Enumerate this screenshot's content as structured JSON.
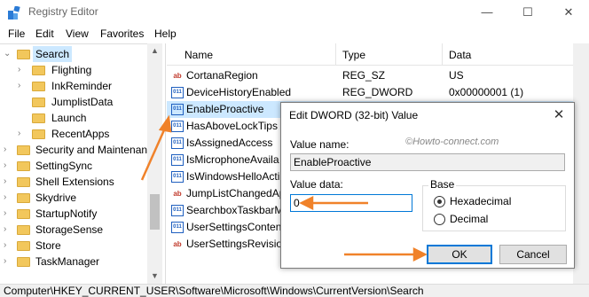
{
  "window": {
    "title": "Registry Editor",
    "controls": {
      "minimize": "—",
      "maximize": "☐",
      "close": "✕"
    }
  },
  "menu": [
    "File",
    "Edit",
    "View",
    "Favorites",
    "Help"
  ],
  "tree": {
    "items": [
      {
        "label": "Search",
        "selected": true
      },
      {
        "label": "Flighting"
      },
      {
        "label": "InkReminder"
      },
      {
        "label": "JumplistData"
      },
      {
        "label": "Launch"
      },
      {
        "label": "RecentApps"
      },
      {
        "label": "Security and Maintenan"
      },
      {
        "label": "SettingSync"
      },
      {
        "label": "Shell Extensions"
      },
      {
        "label": "Skydrive"
      },
      {
        "label": "StartupNotify"
      },
      {
        "label": "StorageSense"
      },
      {
        "label": "Store"
      },
      {
        "label": "TaskManager"
      }
    ]
  },
  "list": {
    "headers": {
      "name": "Name",
      "type": "Type",
      "data": "Data"
    },
    "rows": [
      {
        "name": "CortanaRegion",
        "type": "REG_SZ",
        "data": "US",
        "icon": "string-value-icon"
      },
      {
        "name": "DeviceHistoryEnabled",
        "type": "REG_DWORD",
        "data": "0x00000001 (1)",
        "icon": "dword-value-icon"
      },
      {
        "name": "EnableProactive",
        "type": "",
        "data": "",
        "icon": "dword-value-icon",
        "selected": true
      },
      {
        "name": "HasAboveLockTips",
        "type": "",
        "data": "",
        "icon": "dword-value-icon"
      },
      {
        "name": "IsAssignedAccess",
        "type": "",
        "data": "",
        "icon": "dword-value-icon"
      },
      {
        "name": "IsMicrophoneAvaila",
        "type": "",
        "data": "",
        "icon": "dword-value-icon"
      },
      {
        "name": "IsWindowsHelloActi",
        "type": "",
        "data": "",
        "icon": "dword-value-icon"
      },
      {
        "name": "JumpListChangedAp",
        "type": "",
        "data": "",
        "icon": "string-value-icon"
      },
      {
        "name": "SearchboxTaskbarM",
        "type": "",
        "data": "",
        "icon": "dword-value-icon"
      },
      {
        "name": "UserSettingsContent",
        "type": "",
        "data": "",
        "icon": "dword-value-icon"
      },
      {
        "name": "UserSettingsRevision",
        "type": "",
        "data": "",
        "icon": "string-value-icon"
      }
    ]
  },
  "statusbar": {
    "path": "Computer\\HKEY_CURRENT_USER\\Software\\Microsoft\\Windows\\CurrentVersion\\Search"
  },
  "dialog": {
    "title": "Edit DWORD (32-bit) Value",
    "watermark": "©Howto-connect.com",
    "value_name_label": "Value name:",
    "value_name": "EnableProactive",
    "value_data_label": "Value data:",
    "value_data": "0",
    "base_label": "Base",
    "base_options": [
      "Hexadecimal",
      "Decimal"
    ],
    "base_selected": "Hexadecimal",
    "ok_label": "OK",
    "cancel_label": "Cancel",
    "close": "✕"
  },
  "colors": {
    "arrow": "#f0822a",
    "selection": "#cce8ff",
    "focus": "#0078d7"
  }
}
